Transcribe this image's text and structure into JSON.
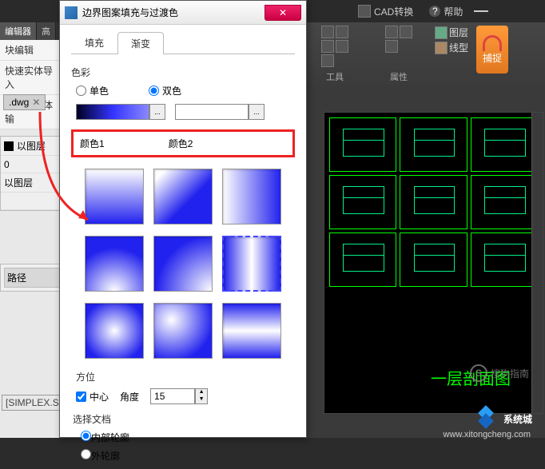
{
  "bg": {
    "cad_convert": "CAD转换",
    "help": "帮助",
    "layer": "图层",
    "linetype": "线型",
    "tools_label": "工具",
    "props_label": "属性",
    "capture": "捕捉",
    "left_tabs": {
      "editor": "编辑器",
      "high": "高"
    },
    "left_items": [
      "块编辑",
      "快速实体导入",
      "多边形实体输"
    ],
    "file_tab": ".dwg",
    "prop_rows": {
      "bylayer1": "以图层",
      "zero": "0",
      "bylayer2": "以图层"
    },
    "path_label": "路径",
    "simplex": "[SIMPLEX.SH",
    "cad_title": "一层剖面图"
  },
  "dialog": {
    "title": "边界图案填充与过渡色",
    "tabs": {
      "fill": "填充",
      "gradient": "渐变"
    },
    "color_label": "色彩",
    "single": "单色",
    "double": "双色",
    "color1": "颜色1",
    "color2": "颜色2",
    "ellipsis": "...",
    "orient_label": "方位",
    "center": "中心",
    "angle_label": "角度",
    "angle_value": "15",
    "select_doc": "选择文档",
    "inner": "内部轮廓",
    "outer": "外轮廓"
  },
  "watermark": {
    "sogou": "搜狗指南",
    "xtc": "系统城",
    "url": "www.xitongcheng.com"
  }
}
